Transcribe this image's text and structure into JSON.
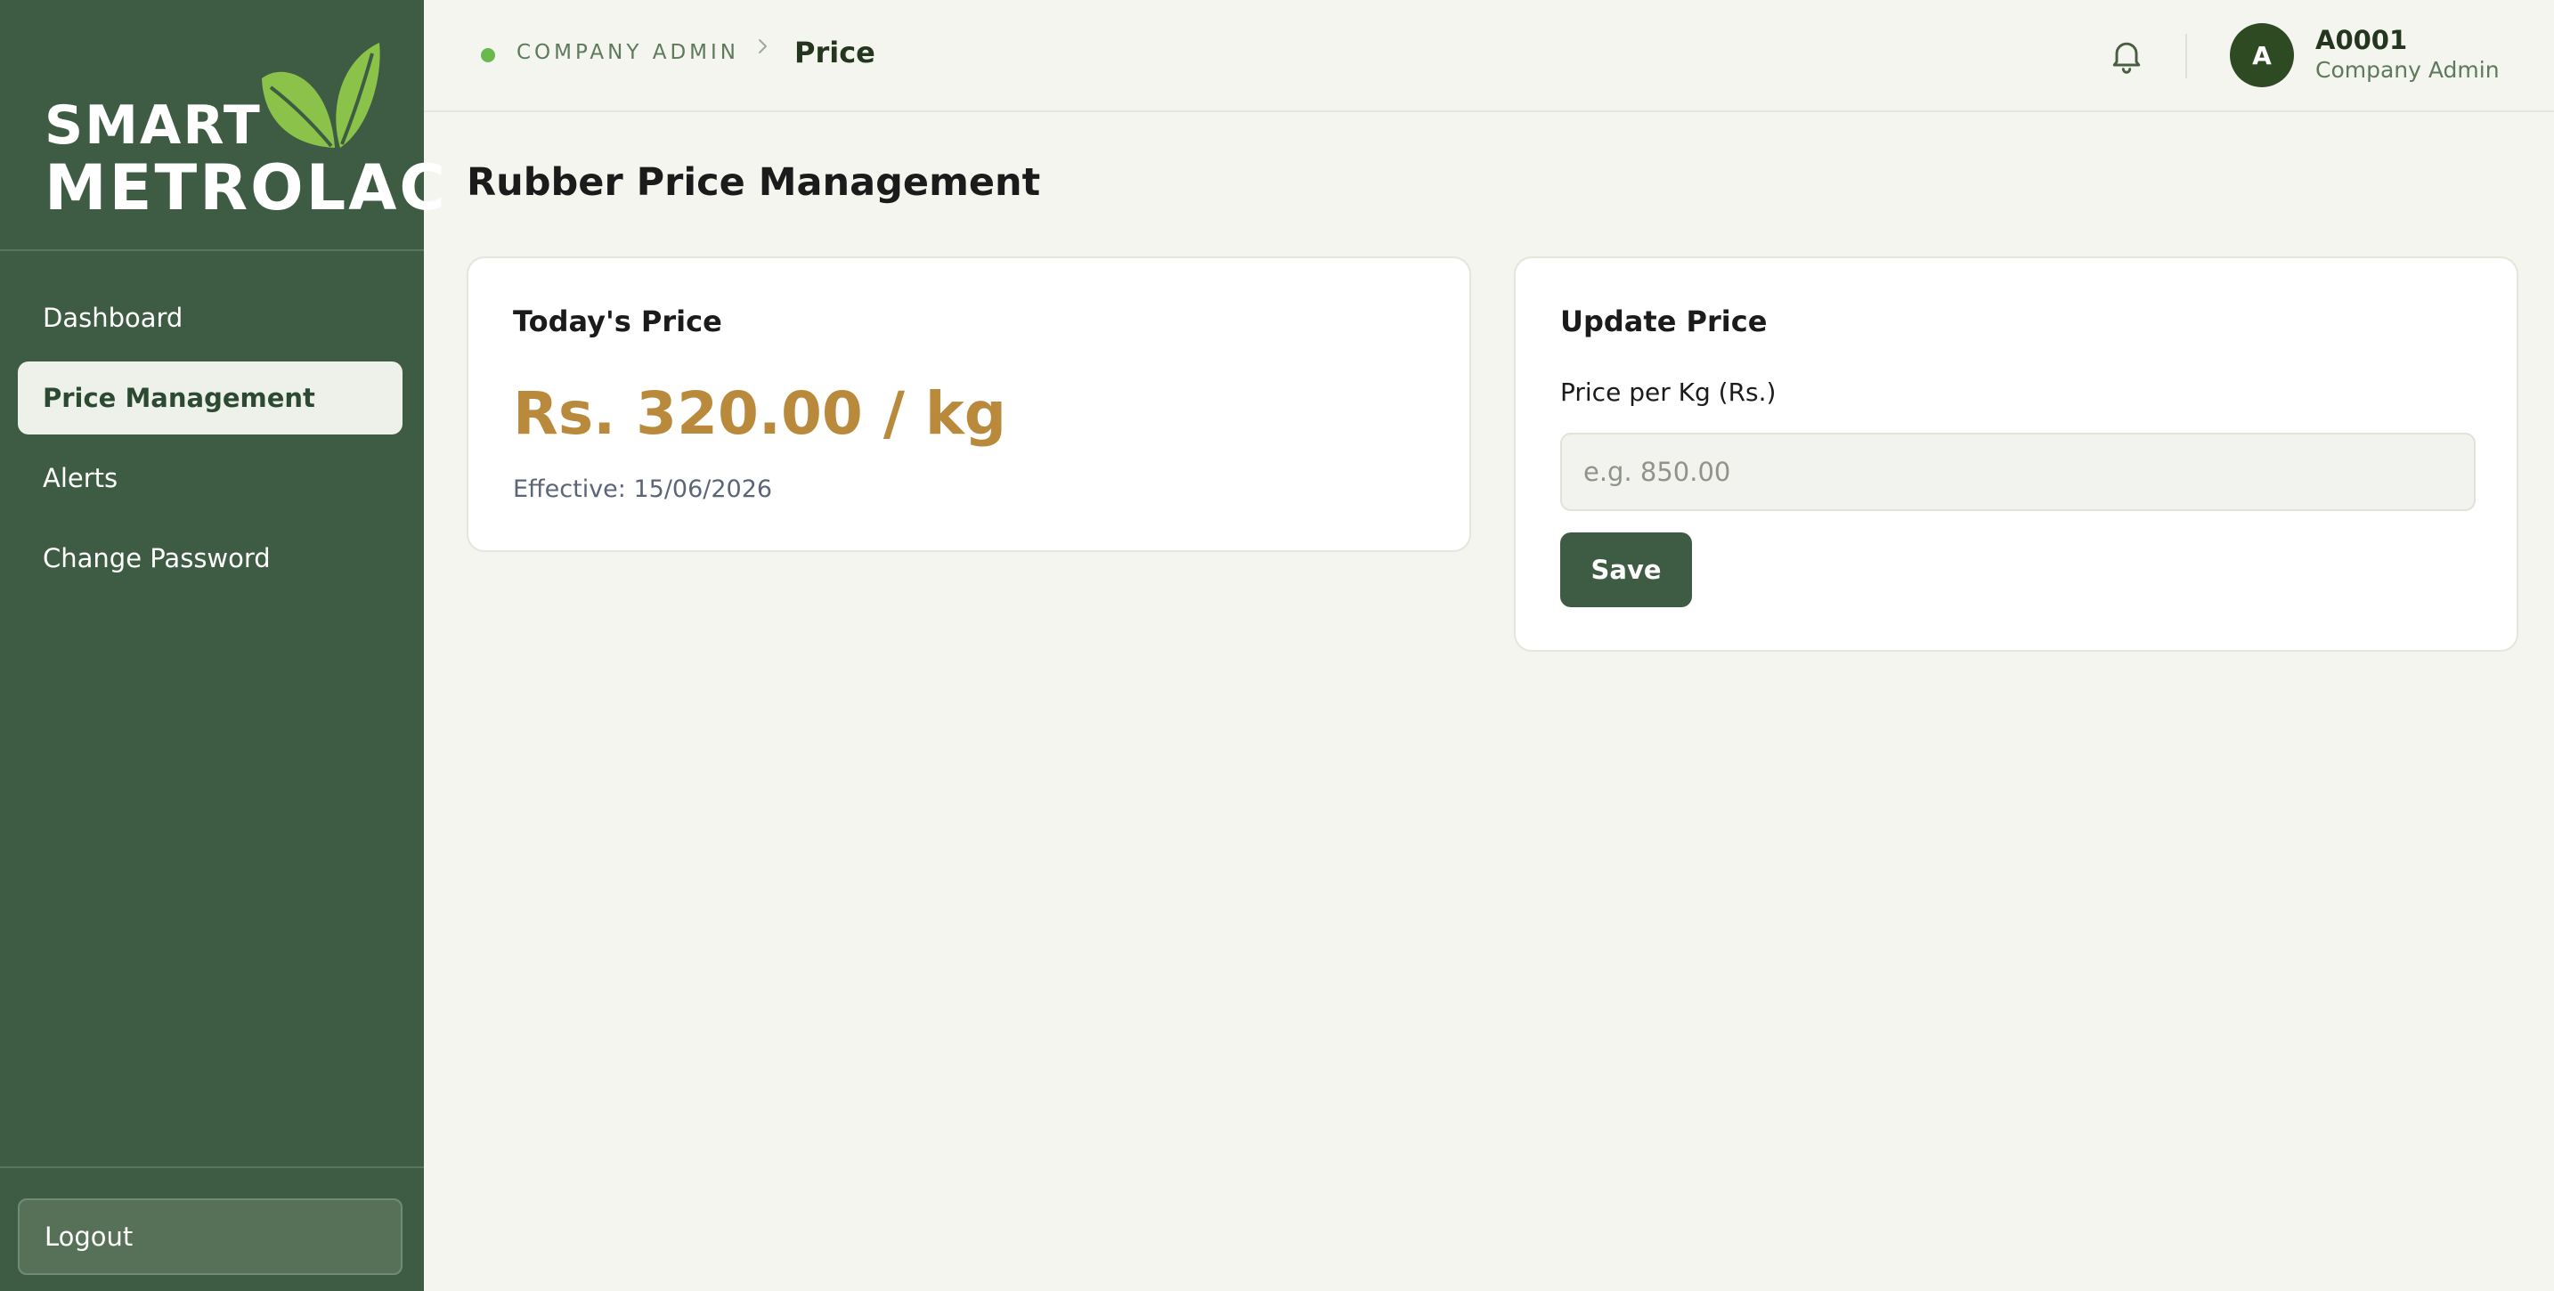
{
  "brand": {
    "line1": "SMART",
    "line2": "METROLAC",
    "leaf_color": "#8bc34a",
    "sidebar_color": "#3e5c43"
  },
  "sidebar": {
    "items": [
      {
        "label": "Dashboard",
        "active": false
      },
      {
        "label": "Price Management",
        "active": true
      },
      {
        "label": "Alerts",
        "active": false
      },
      {
        "label": "Change Password",
        "active": false
      }
    ],
    "logout_label": "Logout"
  },
  "header": {
    "breadcrumb_root": "COMPANY ADMIN",
    "breadcrumb_current": "Price",
    "notification_icon": "bell-icon",
    "user": {
      "initial": "A",
      "id": "A0001",
      "role": "Company Admin"
    }
  },
  "main": {
    "title": "Rubber Price Management",
    "today_card": {
      "title": "Today's Price",
      "price": "Rs. 320.00 / kg",
      "effective": "Effective: 15/06/2026",
      "price_color": "#b98a3c"
    },
    "update_card": {
      "title": "Update Price",
      "field_label": "Price per Kg (Rs.)",
      "input_value": "",
      "input_placeholder": "e.g. 850.00",
      "save_label": "Save"
    }
  }
}
